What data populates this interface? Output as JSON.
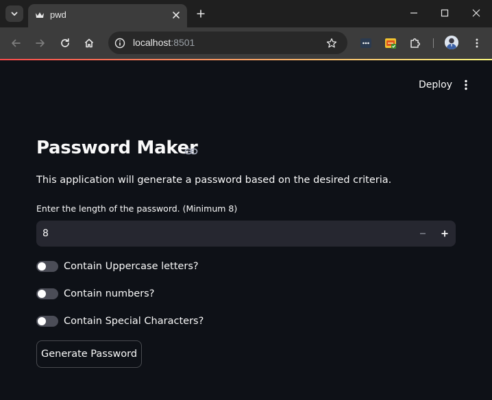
{
  "browser": {
    "tab": {
      "title": "pwd"
    },
    "address": {
      "host": "localhost",
      "port": ":8501"
    },
    "colors": {
      "titlebar": "#1f1f1f",
      "toolbar": "#3c3c3c",
      "omnibox": "#282828"
    }
  },
  "app": {
    "header": {
      "deploy_label": "Deploy"
    },
    "title": "Password Maker",
    "intro": "This application will generate a password based on the desired criteria.",
    "length_field": {
      "label": "Enter the length of the password. (Minimum 8)",
      "value": "8"
    },
    "toggles": [
      {
        "label": "Contain Uppercase letters?",
        "checked": false
      },
      {
        "label": "Contain numbers?",
        "checked": false
      },
      {
        "label": "Contain Special Characters?",
        "checked": false
      }
    ],
    "generate_button": {
      "label": "Generate Password"
    },
    "colors": {
      "background": "#0e1117",
      "input_bg": "#262730",
      "accent_red": "#ff4b4b",
      "accent_yellow": "#fffd80"
    }
  }
}
